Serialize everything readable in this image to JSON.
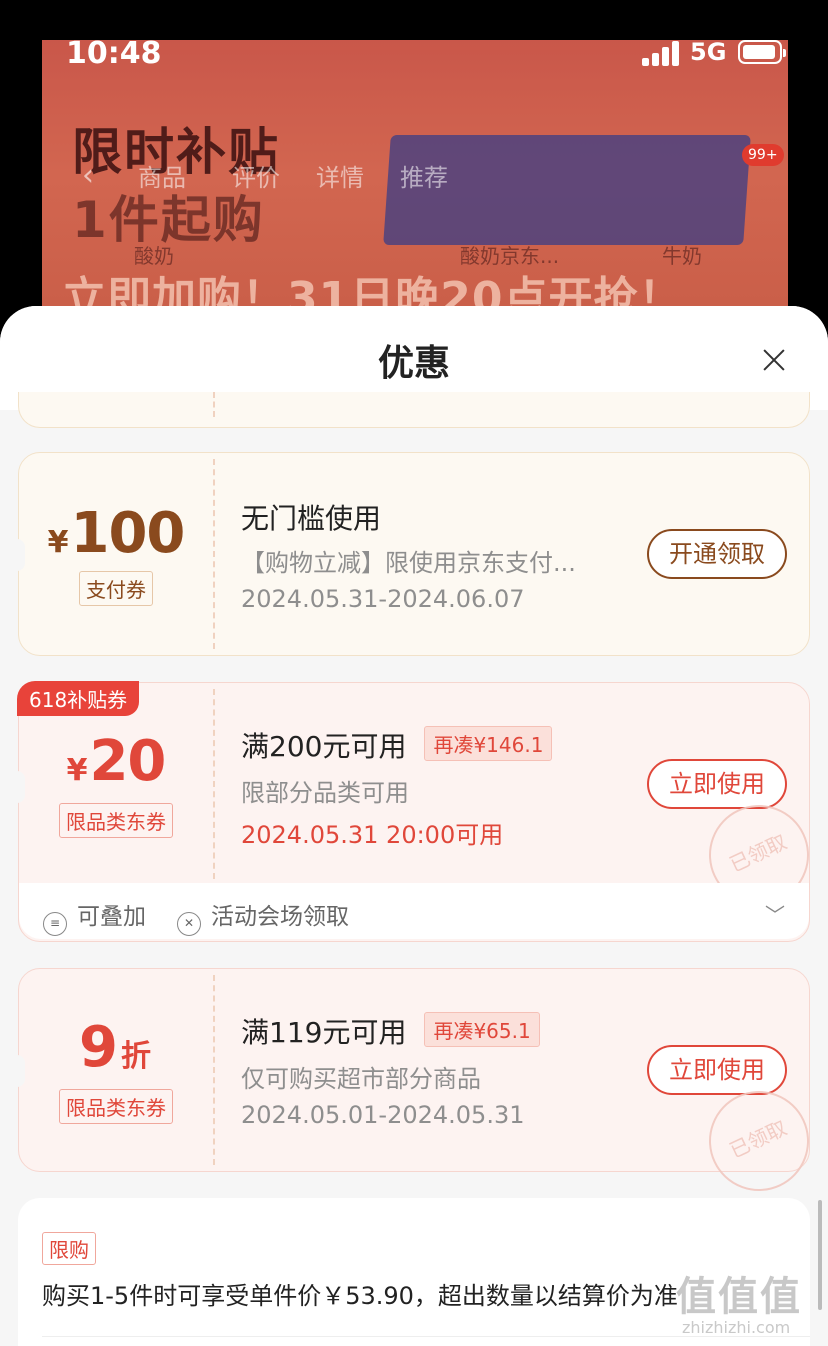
{
  "status_bar": {
    "time": "10:48",
    "network": "5G"
  },
  "background": {
    "banner_line1": "限时补贴",
    "banner_line2": "1件起购",
    "banner_bottom": "立即加购！31日晚20点开抢！",
    "nav_tabs": [
      "商品",
      "评价",
      "详情",
      "推荐"
    ],
    "cart_badge": "99+",
    "categories": [
      "酸奶",
      "酸奶京东...",
      "牛奶"
    ]
  },
  "sheet": {
    "title": "优惠",
    "coupons": [
      {
        "currency": "¥",
        "amount": "100",
        "tag": "支付券",
        "title": "无门槛使用",
        "desc": "【购物立减】限使用京东支付...",
        "date": "2024.05.31-2024.06.07",
        "button": "开通领取"
      },
      {
        "ribbon": "618补贴券",
        "currency": "¥",
        "amount": "20",
        "tag": "限品类东券",
        "title": "满200元可用",
        "chip": "再凑¥146.1",
        "desc": "限部分品类可用",
        "date": "2024.05.31 20:00可用",
        "button": "立即使用",
        "stamp": "已领取",
        "extra": {
          "stackable": "可叠加",
          "venue": "活动会场领取"
        }
      },
      {
        "amount": "9",
        "unit": "折",
        "tag": "限品类东券",
        "title": "满119元可用",
        "chip": "再凑¥65.1",
        "desc": "仅可购买超市部分商品",
        "date": "2024.05.01-2024.05.31",
        "button": "立即使用",
        "stamp": "已领取"
      }
    ],
    "limit": {
      "tag": "限购",
      "text": "购买1-5件时可享受单件价￥53.90，超出数量以结算价为准"
    }
  },
  "watermark": {
    "text": "值值值",
    "sub": "zhizhizhi.com"
  },
  "colors": {
    "accent_red": "#e0473a",
    "gold_brown": "#8a4a1e",
    "sheet_bg": "#f6f6f6"
  }
}
